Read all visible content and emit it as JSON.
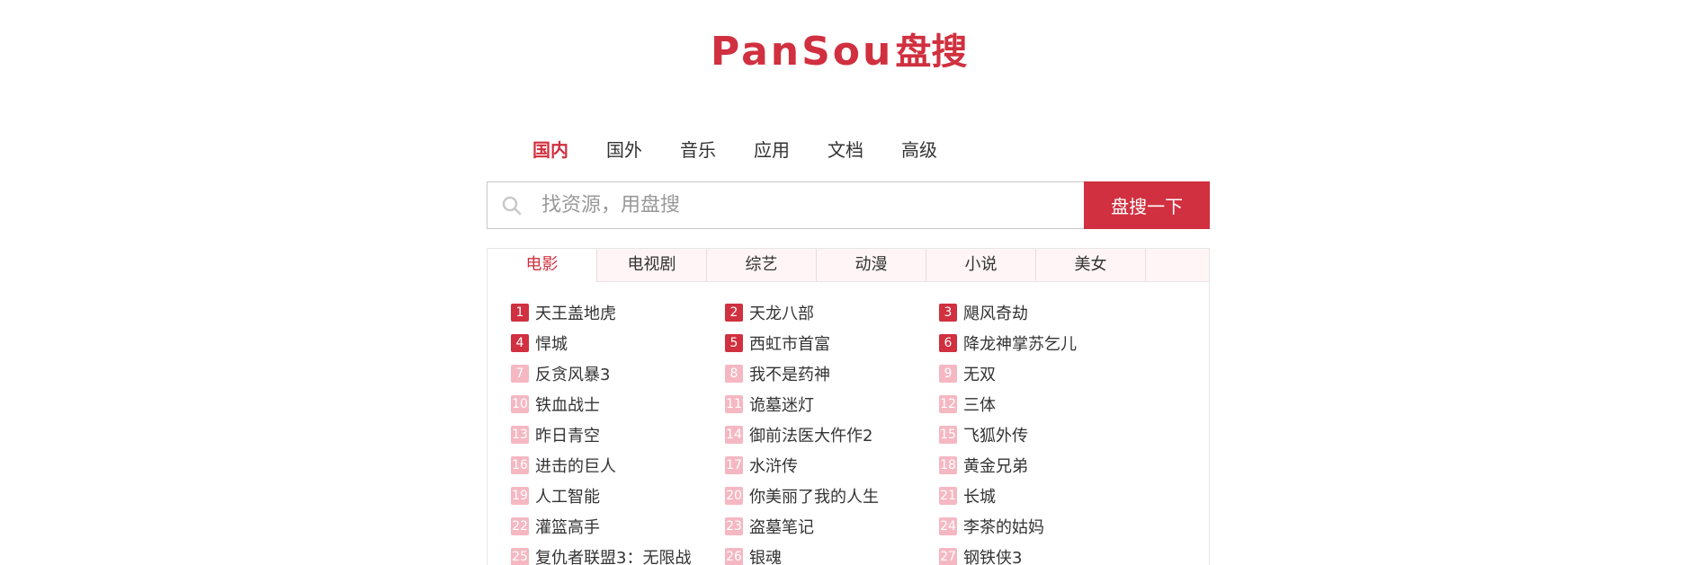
{
  "logo": {
    "text": "PanSou",
    "cn": "盘搜"
  },
  "nav": [
    {
      "label": "国内",
      "active": true
    },
    {
      "label": "国外",
      "active": false
    },
    {
      "label": "音乐",
      "active": false
    },
    {
      "label": "应用",
      "active": false
    },
    {
      "label": "文档",
      "active": false
    },
    {
      "label": "高级",
      "active": false
    }
  ],
  "search": {
    "placeholder": "找资源，用盘搜",
    "button_label": "盘搜一下"
  },
  "tabs": [
    {
      "label": "电影",
      "active": true
    },
    {
      "label": "电视剧",
      "active": false
    },
    {
      "label": "综艺",
      "active": false
    },
    {
      "label": "动漫",
      "active": false
    },
    {
      "label": "小说",
      "active": false
    },
    {
      "label": "美女",
      "active": false
    }
  ],
  "ranking": [
    {
      "rank": "1",
      "title": "天王盖地虎"
    },
    {
      "rank": "2",
      "title": "天龙八部"
    },
    {
      "rank": "3",
      "title": "飓风奇劫"
    },
    {
      "rank": "4",
      "title": "悍城"
    },
    {
      "rank": "5",
      "title": "西虹市首富"
    },
    {
      "rank": "6",
      "title": "降龙神掌苏乞儿"
    },
    {
      "rank": "7",
      "title": "反贪风暴3"
    },
    {
      "rank": "8",
      "title": "我不是药神"
    },
    {
      "rank": "9",
      "title": "无双"
    },
    {
      "rank": "10",
      "title": "铁血战士"
    },
    {
      "rank": "11",
      "title": "诡墓迷灯"
    },
    {
      "rank": "12",
      "title": "三体"
    },
    {
      "rank": "13",
      "title": "昨日青空"
    },
    {
      "rank": "14",
      "title": "御前法医大仵作2"
    },
    {
      "rank": "15",
      "title": "飞狐外传"
    },
    {
      "rank": "16",
      "title": "进击的巨人"
    },
    {
      "rank": "17",
      "title": "水浒传"
    },
    {
      "rank": "18",
      "title": "黄金兄弟"
    },
    {
      "rank": "19",
      "title": "人工智能"
    },
    {
      "rank": "20",
      "title": "你美丽了我的人生"
    },
    {
      "rank": "21",
      "title": "长城"
    },
    {
      "rank": "22",
      "title": "灌篮高手"
    },
    {
      "rank": "23",
      "title": "盗墓笔记"
    },
    {
      "rank": "24",
      "title": "李茶的姑妈"
    },
    {
      "rank": "25",
      "title": "复仇者联盟3：无限战"
    },
    {
      "rank": "26",
      "title": "银魂"
    },
    {
      "rank": "27",
      "title": "钢铁侠3"
    }
  ],
  "colors": {
    "accent": "#d0303f",
    "rank_top": "#d0303f",
    "rank_other": "#f5b8c2"
  }
}
